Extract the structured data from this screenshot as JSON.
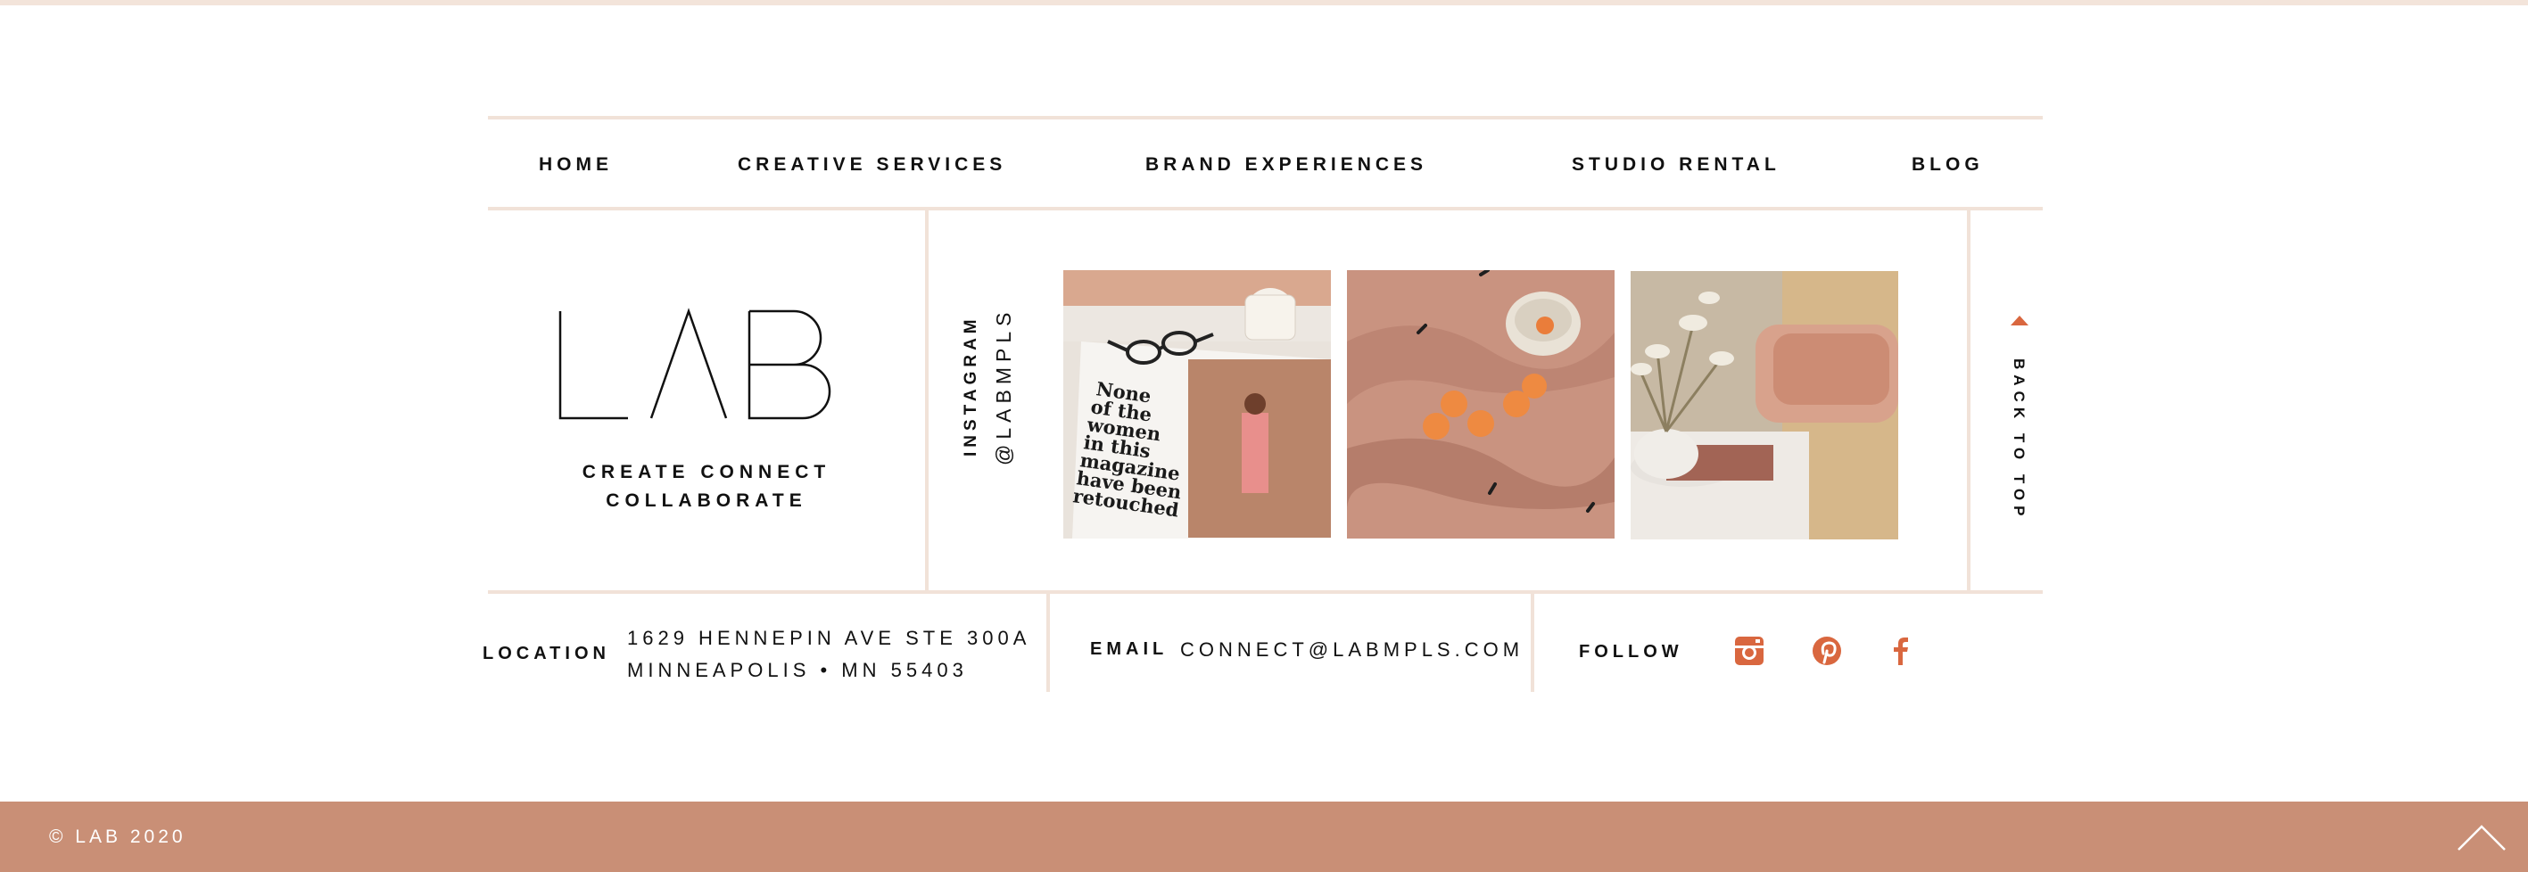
{
  "nav": {
    "items": [
      {
        "label": "HOME"
      },
      {
        "label": "CREATIVE SERVICES"
      },
      {
        "label": "BRAND EXPERIENCES"
      },
      {
        "label": "STUDIO RENTAL"
      },
      {
        "label": "BLOG"
      }
    ]
  },
  "brand": {
    "logo_text": "LAB",
    "tagline_line1": "CREATE  CONNECT",
    "tagline_line2": "COLLABORATE"
  },
  "instagram": {
    "label": "INSTAGRAM",
    "handle": "@LABMPLS",
    "photos": [
      {
        "name": "magazine-candle-photo",
        "magazine_text": [
          "None",
          "of the",
          "women",
          "in this",
          "magazine",
          "have been",
          "retouched"
        ]
      },
      {
        "name": "oranges-blanket-photo"
      },
      {
        "name": "flowers-chair-photo"
      }
    ]
  },
  "back_to_top": {
    "label": "BACK TO TOP"
  },
  "info": {
    "location_label": "LOCATION",
    "address_line1": "1629 HENNEPIN AVE STE 300A",
    "address_line2": "MINNEAPOLIS • MN 55403",
    "email_label": "EMAIL",
    "email_value": "CONNECT@LABMPLS.COM",
    "follow_label": "FOLLOW",
    "social_icons": [
      "instagram-icon",
      "pinterest-icon",
      "facebook-icon"
    ]
  },
  "footer": {
    "copyright": "© LAB 2020"
  },
  "colors": {
    "accent": "#d9673f",
    "footer_bg": "#c98f76",
    "divider": "#f1e2d8"
  }
}
